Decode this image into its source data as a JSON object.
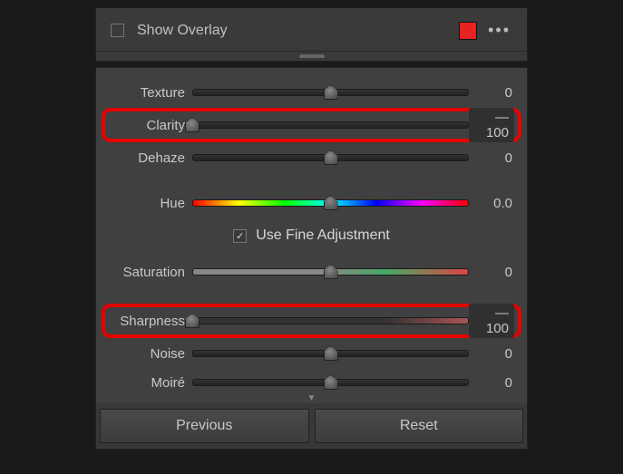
{
  "header": {
    "show_overlay_label": "Show Overlay",
    "swatch_color": "#e62222"
  },
  "sliders": {
    "texture": {
      "label": "Texture",
      "value": "0",
      "pos": 0.5
    },
    "clarity": {
      "label": "Clarity",
      "value": "— 100",
      "pos": 0.0
    },
    "dehaze": {
      "label": "Dehaze",
      "value": "0",
      "pos": 0.5
    },
    "hue": {
      "label": "Hue",
      "value": "0.0",
      "pos": 0.5
    },
    "saturation": {
      "label": "Saturation",
      "value": "0",
      "pos": 0.5
    },
    "sharpness": {
      "label": "Sharpness",
      "value": "— 100",
      "pos": 0.0
    },
    "noise": {
      "label": "Noise",
      "value": "0",
      "pos": 0.5
    },
    "moire": {
      "label": "Moiré",
      "value": "0",
      "pos": 0.5
    }
  },
  "fine_adjust_label": "Use Fine Adjustment",
  "footer": {
    "previous": "Previous",
    "reset": "Reset"
  }
}
